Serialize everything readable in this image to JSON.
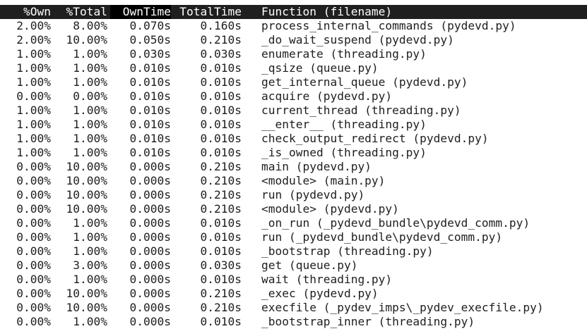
{
  "header": {
    "own_pct": "%Own",
    "total_pct": "%Total",
    "own_time": "OwnTime",
    "total_time": "TotalTime",
    "function": "Function (filename)",
    "sorted_column": "OwnTime"
  },
  "rows": [
    {
      "own_pct": "2.00%",
      "total_pct": "8.00%",
      "own_time": "0.070s",
      "total_time": "0.160s",
      "function": "process_internal_commands (pydevd.py)"
    },
    {
      "own_pct": "2.00%",
      "total_pct": "10.00%",
      "own_time": "0.050s",
      "total_time": "0.210s",
      "function": "_do_wait_suspend (pydevd.py)"
    },
    {
      "own_pct": "1.00%",
      "total_pct": "1.00%",
      "own_time": "0.030s",
      "total_time": "0.030s",
      "function": "enumerate (threading.py)"
    },
    {
      "own_pct": "1.00%",
      "total_pct": "1.00%",
      "own_time": "0.010s",
      "total_time": "0.010s",
      "function": "_qsize (queue.py)"
    },
    {
      "own_pct": "1.00%",
      "total_pct": "1.00%",
      "own_time": "0.010s",
      "total_time": "0.010s",
      "function": "get_internal_queue (pydevd.py)"
    },
    {
      "own_pct": "0.00%",
      "total_pct": "0.00%",
      "own_time": "0.010s",
      "total_time": "0.010s",
      "function": "acquire (pydevd.py)"
    },
    {
      "own_pct": "1.00%",
      "total_pct": "1.00%",
      "own_time": "0.010s",
      "total_time": "0.010s",
      "function": "current_thread (threading.py)"
    },
    {
      "own_pct": "1.00%",
      "total_pct": "1.00%",
      "own_time": "0.010s",
      "total_time": "0.010s",
      "function": "__enter__ (threading.py)"
    },
    {
      "own_pct": "1.00%",
      "total_pct": "1.00%",
      "own_time": "0.010s",
      "total_time": "0.010s",
      "function": "check_output_redirect (pydevd.py)"
    },
    {
      "own_pct": "1.00%",
      "total_pct": "1.00%",
      "own_time": "0.010s",
      "total_time": "0.010s",
      "function": "_is_owned (threading.py)"
    },
    {
      "own_pct": "0.00%",
      "total_pct": "10.00%",
      "own_time": "0.000s",
      "total_time": "0.210s",
      "function": "main (pydevd.py)"
    },
    {
      "own_pct": "0.00%",
      "total_pct": "10.00%",
      "own_time": "0.000s",
      "total_time": "0.210s",
      "function": "<module> (main.py)"
    },
    {
      "own_pct": "0.00%",
      "total_pct": "10.00%",
      "own_time": "0.000s",
      "total_time": "0.210s",
      "function": "run (pydevd.py)"
    },
    {
      "own_pct": "0.00%",
      "total_pct": "10.00%",
      "own_time": "0.000s",
      "total_time": "0.210s",
      "function": "<module> (pydevd.py)"
    },
    {
      "own_pct": "0.00%",
      "total_pct": "1.00%",
      "own_time": "0.000s",
      "total_time": "0.010s",
      "function": "_on_run (_pydevd_bundle\\pydevd_comm.py)"
    },
    {
      "own_pct": "0.00%",
      "total_pct": "1.00%",
      "own_time": "0.000s",
      "total_time": "0.010s",
      "function": "run (_pydevd_bundle\\pydevd_comm.py)"
    },
    {
      "own_pct": "0.00%",
      "total_pct": "1.00%",
      "own_time": "0.000s",
      "total_time": "0.010s",
      "function": "_bootstrap (threading.py)"
    },
    {
      "own_pct": "0.00%",
      "total_pct": "3.00%",
      "own_time": "0.000s",
      "total_time": "0.030s",
      "function": "get (queue.py)"
    },
    {
      "own_pct": "0.00%",
      "total_pct": "1.00%",
      "own_time": "0.000s",
      "total_time": "0.010s",
      "function": "wait (threading.py)"
    },
    {
      "own_pct": "0.00%",
      "total_pct": "10.00%",
      "own_time": "0.000s",
      "total_time": "0.210s",
      "function": "_exec (pydevd.py)"
    },
    {
      "own_pct": "0.00%",
      "total_pct": "10.00%",
      "own_time": "0.000s",
      "total_time": "0.210s",
      "function": "execfile (_pydev_imps\\_pydev_execfile.py)"
    },
    {
      "own_pct": "0.00%",
      "total_pct": "1.00%",
      "own_time": "0.000s",
      "total_time": "0.010s",
      "function": "_bootstrap_inner (threading.py)"
    }
  ]
}
